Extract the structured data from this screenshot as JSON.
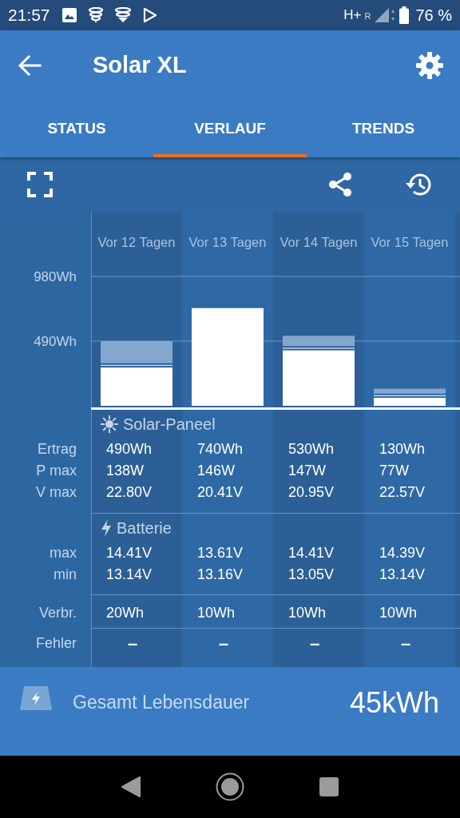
{
  "status_bar": {
    "time": "21:57",
    "network": "H+",
    "roaming": "R",
    "battery": "76 %"
  },
  "app_bar": {
    "title": "Solar XL"
  },
  "tabs": [
    {
      "label": "STATUS",
      "selected": false
    },
    {
      "label": "VERLAUF",
      "selected": true
    },
    {
      "label": "TRENDS",
      "selected": false
    }
  ],
  "history": {
    "chart_data": {
      "type": "bar",
      "stacked": true,
      "categories": [
        "Vor 12 Tagen",
        "Vor 13 Tagen",
        "Vor 14 Tagen",
        "Vor 15 Tagen"
      ],
      "series": [
        {
          "color": "#ffffff",
          "values": [
            290,
            740,
            420,
            60
          ]
        },
        {
          "color": "#dce6f1",
          "values": [
            20,
            0,
            20,
            20
          ]
        },
        {
          "color": "#84a7cf",
          "values": [
            180,
            0,
            90,
            50
          ]
        }
      ],
      "ylim": [
        0,
        1470
      ],
      "yticks": [
        {
          "value": 490,
          "label": "490Wh"
        },
        {
          "value": 980,
          "label": "980Wh"
        }
      ]
    },
    "groups": [
      {
        "kind": "solar",
        "title": "Solar-Paneel",
        "rows": [
          {
            "label": "Ertrag",
            "values": [
              "490Wh",
              "740Wh",
              "530Wh",
              "130Wh"
            ]
          },
          {
            "label": "P max",
            "values": [
              "138W",
              "146W",
              "147W",
              "77W"
            ]
          },
          {
            "label": "V max",
            "values": [
              "22.80V",
              "20.41V",
              "20.95V",
              "22.57V"
            ]
          }
        ]
      },
      {
        "kind": "battery",
        "title": "Batterie",
        "rows": [
          {
            "label": "max",
            "values": [
              "14.41V",
              "13.61V",
              "14.41V",
              "14.39V"
            ]
          },
          {
            "label": "min",
            "values": [
              "13.14V",
              "13.16V",
              "13.05V",
              "13.14V"
            ]
          }
        ]
      },
      {
        "kind": "plain",
        "rows": [
          {
            "label": "Verbr.",
            "values": [
              "20Wh",
              "10Wh",
              "10Wh",
              "10Wh"
            ]
          }
        ]
      },
      {
        "kind": "errors",
        "rows": [
          {
            "label": "Fehler",
            "values": [
              "–",
              "–",
              "–",
              "–"
            ]
          }
        ]
      }
    ]
  },
  "lifetime": {
    "label": "Gesamt Lebensdauer",
    "value": "45kWh"
  }
}
